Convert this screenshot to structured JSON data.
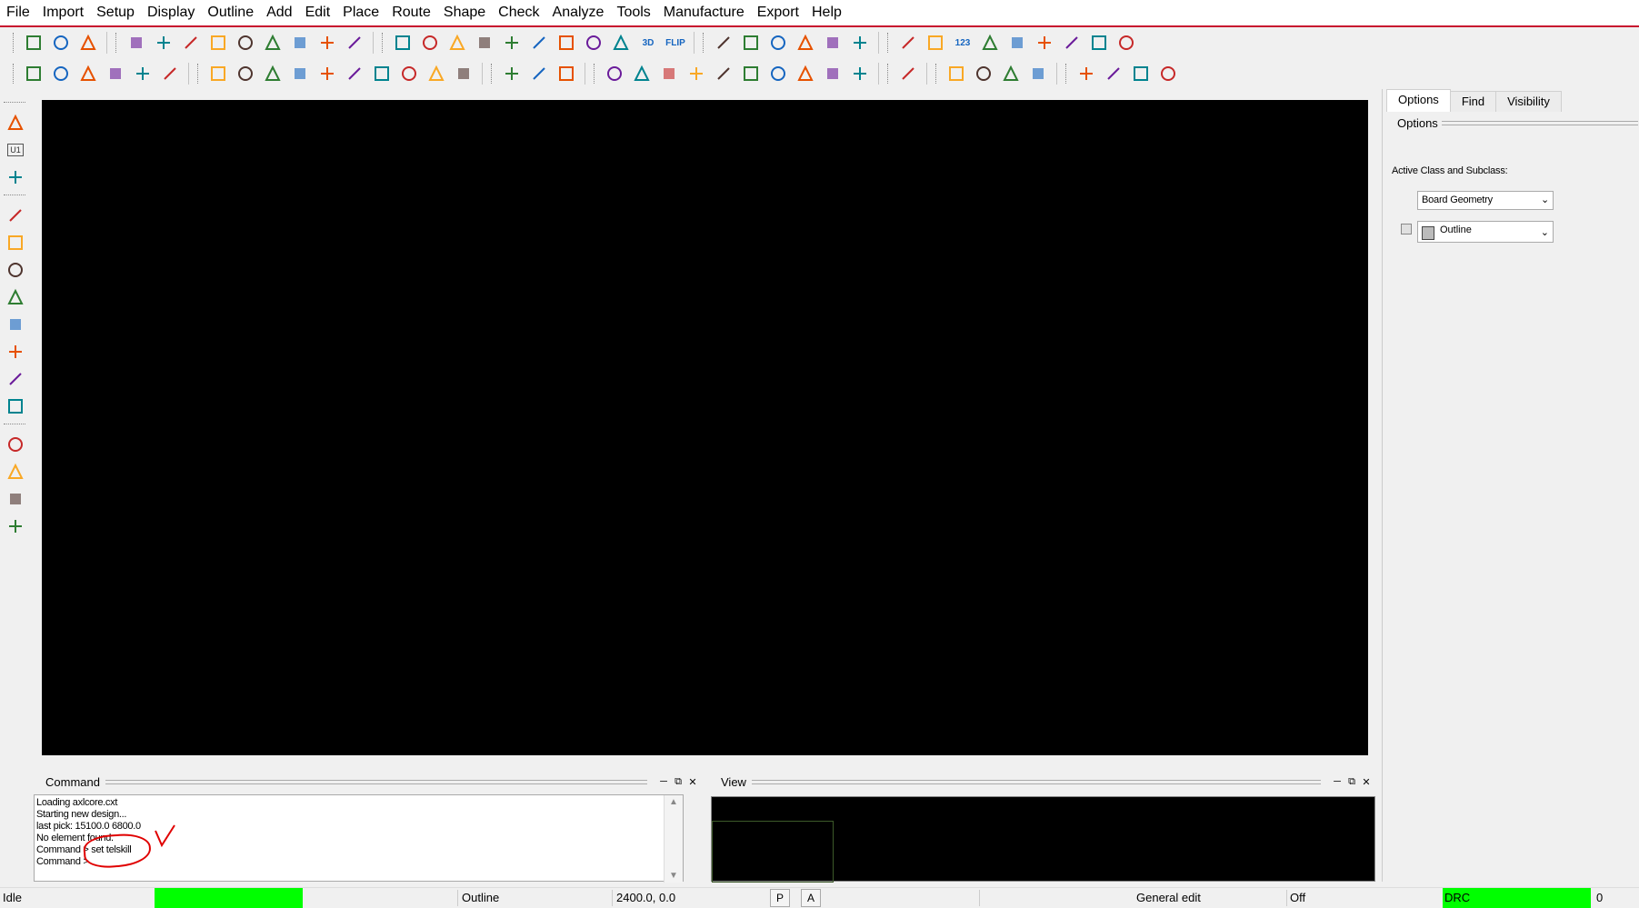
{
  "menubar": {
    "items": [
      "File",
      "Import",
      "Setup",
      "Display",
      "Outline",
      "Add",
      "Edit",
      "Place",
      "Route",
      "Shape",
      "Check",
      "Analyze",
      "Tools",
      "Manufacture",
      "Export",
      "Help"
    ]
  },
  "toolbar_row1": {
    "icons": [
      "new-file-icon",
      "open-file-icon",
      "save-icon",
      "move-icon",
      "copy-icon",
      "delete-icon",
      "undo-icon",
      "undo-dropdown-icon",
      "redo-icon",
      "redo-dropdown-icon",
      "snap-icon",
      "pin-icon",
      "grid-select-icon",
      "grid-toggle-icon",
      "zoom-fit-icon",
      "zoom-window-icon",
      "zoom-in-icon",
      "zoom-out-icon",
      "zoom-world-icon",
      "zoom-center-icon",
      "refresh-icon",
      "view-3d-icon",
      "flip-icon",
      "grid-icon",
      "color-icon",
      "layers-icon",
      "stack-icon",
      "board-icon",
      "component-icon",
      "info-icon",
      "properties-icon",
      "measure-icon",
      "highlight-icon",
      "shadow-icon",
      "light-icon",
      "bars-icon",
      "hourglass-icon",
      "design-compare-icon"
    ],
    "labels": {
      "view_3d": "3D",
      "flip": "FLIP",
      "measure": "123"
    }
  },
  "toolbar_row2": {
    "icons": [
      "layer-1-icon",
      "layer-2-icon",
      "layer-3-icon",
      "layer-4-icon",
      "layer-5-icon",
      "layer-6-icon",
      "add-line-icon",
      "add-rect-icon",
      "add-circle-icon",
      "select-icon",
      "fillet-icon",
      "arc-icon",
      "frame-icon",
      "circle-frame-icon",
      "shape-icon",
      "stamp-icon",
      "package-icon",
      "dimension-icon",
      "measure-width-icon",
      "odb-icon",
      "book-icon",
      "graph-icon",
      "camera-icon",
      "pin-number-icon",
      "flag-icon",
      "matrix-icon",
      "net-icon",
      "array-icon",
      "array2-icon",
      "waveform-icon",
      "report-icon",
      "package-open-icon",
      "gift-icon",
      "checklist-icon",
      "window-stack-icon",
      "mail-icon",
      "envelope-icon",
      "help-icon"
    ]
  },
  "left_toolbar": {
    "icons": [
      "place-component-icon",
      "u1-component-icon",
      "swap-icon",
      "route-icon",
      "route-box-icon",
      "wave-route-icon",
      "fanout-icon",
      "arrow-route-icon",
      "list-icon",
      "grid-route-icon",
      "tune-icon",
      "line-tool-icon",
      "rect-tool-icon",
      "add-text-icon",
      "edit-text-icon"
    ],
    "labels": {
      "u1": "U1"
    }
  },
  "command_panel": {
    "title": "Command",
    "lines": [
      "Loading axlcore.cxt",
      "Starting new design...",
      "last pick:  15100.0 6800.0",
      "No element found.",
      "Command >  set telskill",
      "Command >"
    ]
  },
  "view_panel": {
    "title": "View"
  },
  "right_panel": {
    "tabs": [
      "Options",
      "Find",
      "Visibility"
    ],
    "active_tab": "Options",
    "header": "Options",
    "active_class_label": "Active Class and Subclass:",
    "class_value": "Board Geometry",
    "subclass_value": "Outline"
  },
  "statusbar": {
    "state": "Idle",
    "active_subclass": "Outline",
    "coordinates": "2400.0, 0.0",
    "p_button": "P",
    "a_button": "A",
    "mode": "General edit",
    "off_label": "Off",
    "drc_label": "DRC",
    "drc_count": "0"
  },
  "colors": {
    "accent_red": "#c8102e",
    "status_green": "#00ff00",
    "canvas_bg": "#000000",
    "annotation_red": "#e00000"
  }
}
